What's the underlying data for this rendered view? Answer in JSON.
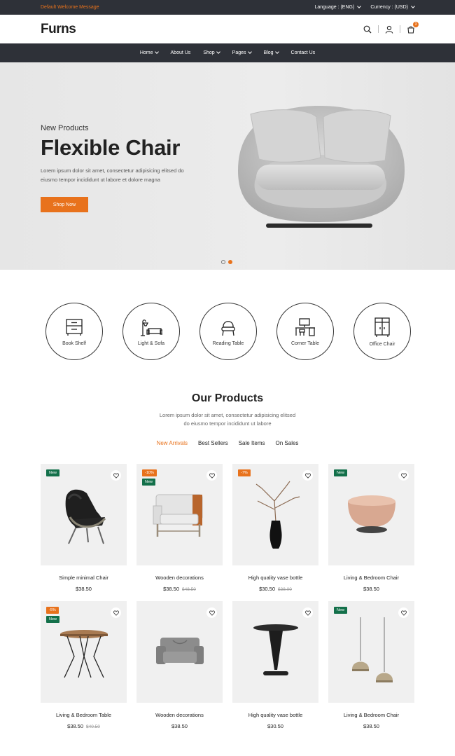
{
  "topbar": {
    "welcome": "Default Welcome Message",
    "language_label": "Language : (ENG)",
    "currency_label": "Currency : (USD)"
  },
  "header": {
    "logo": "Furns",
    "cart_count": "3"
  },
  "nav": {
    "items": [
      {
        "label": "Home",
        "dropdown": true
      },
      {
        "label": "About Us",
        "dropdown": false
      },
      {
        "label": "Shop",
        "dropdown": true
      },
      {
        "label": "Pages",
        "dropdown": true
      },
      {
        "label": "Blog",
        "dropdown": true
      },
      {
        "label": "Contact Us",
        "dropdown": false
      }
    ]
  },
  "hero": {
    "subtitle": "New Products",
    "title": "Flexible Chair",
    "description": "Lorem ipsum dolor sit amet, consectetur adipisicing elitsed do eiusmo tempor incididunt ut labore et dolore magna",
    "button": "Shop Now",
    "slide_count": 2,
    "active_slide": 2
  },
  "categories": [
    {
      "label": "Book Shelf",
      "icon": "book-shelf-icon"
    },
    {
      "label": "Light & Sofa",
      "icon": "lamp-sofa-icon"
    },
    {
      "label": "Reading Table",
      "icon": "reading-chair-icon"
    },
    {
      "label": "Corner Table",
      "icon": "corner-desk-icon"
    },
    {
      "label": "Office Chair",
      "icon": "cabinet-icon"
    }
  ],
  "products_section": {
    "title": "Our Products",
    "description_line1": "Lorem ipsum dolor sit amet, consectetur adipisicing elitsed",
    "description_line2": "do eiusmo tempor incididunt ut labore",
    "tabs": [
      "New Arrivals",
      "Best Sellers",
      "Sale Items",
      "On Sales"
    ],
    "active_tab": 0
  },
  "products": [
    {
      "name": "Simple minimal Chair",
      "price": "$38.50",
      "old_price": "",
      "badges": [
        {
          "text": "New",
          "kind": "new"
        }
      ],
      "art": "lounge-chair"
    },
    {
      "name": "Wooden decorations",
      "price": "$38.50",
      "old_price": "$48.50",
      "badges": [
        {
          "text": "-10%",
          "kind": "sale"
        },
        {
          "text": "New",
          "kind": "new"
        }
      ],
      "art": "armchair"
    },
    {
      "name": "High quality vase bottle",
      "price": "$30.50",
      "old_price": "$38.00",
      "badges": [
        {
          "text": "-7%",
          "kind": "sale"
        }
      ],
      "art": "vase"
    },
    {
      "name": "Living & Bedroom Chair",
      "price": "$38.50",
      "old_price": "",
      "badges": [
        {
          "text": "New",
          "kind": "new"
        }
      ],
      "art": "pouf"
    },
    {
      "name": "Living & Bedroom Table",
      "price": "$38.50",
      "old_price": "$40.50",
      "badges": [
        {
          "text": "-5%",
          "kind": "sale"
        },
        {
          "text": "New",
          "kind": "new"
        }
      ],
      "art": "side-table"
    },
    {
      "name": "Wooden decorations",
      "price": "$38.50",
      "old_price": "",
      "badges": [],
      "art": "sofa"
    },
    {
      "name": "High quality vase bottle",
      "price": "$30.50",
      "old_price": "",
      "badges": [],
      "art": "bar-table"
    },
    {
      "name": "Living & Bedroom Chair",
      "price": "$38.50",
      "old_price": "",
      "badges": [
        {
          "text": "New",
          "kind": "new"
        }
      ],
      "art": "pendant-lamps"
    }
  ],
  "colors": {
    "accent": "#e8721c",
    "dark": "#2e3138",
    "badge_new": "#13704a"
  }
}
